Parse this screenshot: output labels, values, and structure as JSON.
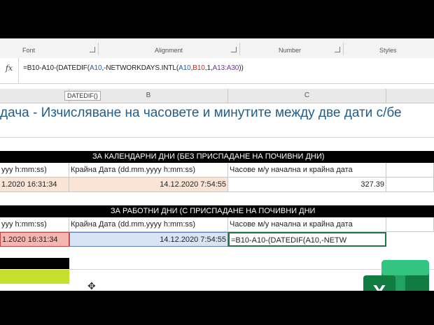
{
  "ribbon": {
    "groups": [
      "Font",
      "Alignment",
      "Number",
      "Styles"
    ]
  },
  "formula_bar": {
    "fx_label": "fx",
    "parts": [
      {
        "text": "=B10-A10-(DATEDIF(",
        "color": "dark"
      },
      {
        "text": "A10",
        "color": "blue"
      },
      {
        "text": ",-NETWORKDAYS.INTL(",
        "color": "dark"
      },
      {
        "text": "A10",
        "color": "blue"
      },
      {
        "text": ",",
        "color": "dark"
      },
      {
        "text": "B10",
        "color": "red"
      },
      {
        "text": ",1,",
        "color": "dark"
      },
      {
        "text": "A13:A30",
        "color": "purple"
      },
      {
        "text": "))",
        "color": "dark"
      }
    ]
  },
  "tooltip": "DATEDIF()",
  "columns": [
    "B",
    "C"
  ],
  "title": "дача - Изчисляване на часовете и минутите между две дати с/бе",
  "section1": {
    "header": "ЗА КАЛЕНДАРНИ ДНИ (БЕЗ ПРИСПАДАНЕ НА ПОЧИВНИ ДНИ)",
    "labels": [
      "yyy h:mm:ss)",
      "Крайна Дата (dd.mm.yyyy h:mm:ss)",
      "Часове м/у начална и крайна дата"
    ],
    "values": [
      "1.2020 16:31:34",
      "14.12.2020 7:54:55",
      "327.39"
    ]
  },
  "section2": {
    "header": "ЗА РАБОТНИ ДНИ (С ПРИСПАДАНЕ НА ПОЧИВНИ ДНИ",
    "labels": [
      "yyy h:mm:ss)",
      "Крайна Дата (dd.mm.yyyy h:mm:ss)",
      "Часове м/у начална и крайна дата"
    ],
    "values": [
      "1.2020 16:31:34",
      "14.12.2020 7:54:55",
      "=B10-A10-(DATEDIF(A10,-NETW"
    ]
  },
  "colors": {
    "accent_title": "#1f5e8a",
    "peach": "#fbe4d5",
    "red_fill": "#f4b6b0",
    "lavender": "#dae3f3",
    "yellow_green": "#c4e02c",
    "excel_green": "#107c41"
  },
  "logo_letter": "X"
}
